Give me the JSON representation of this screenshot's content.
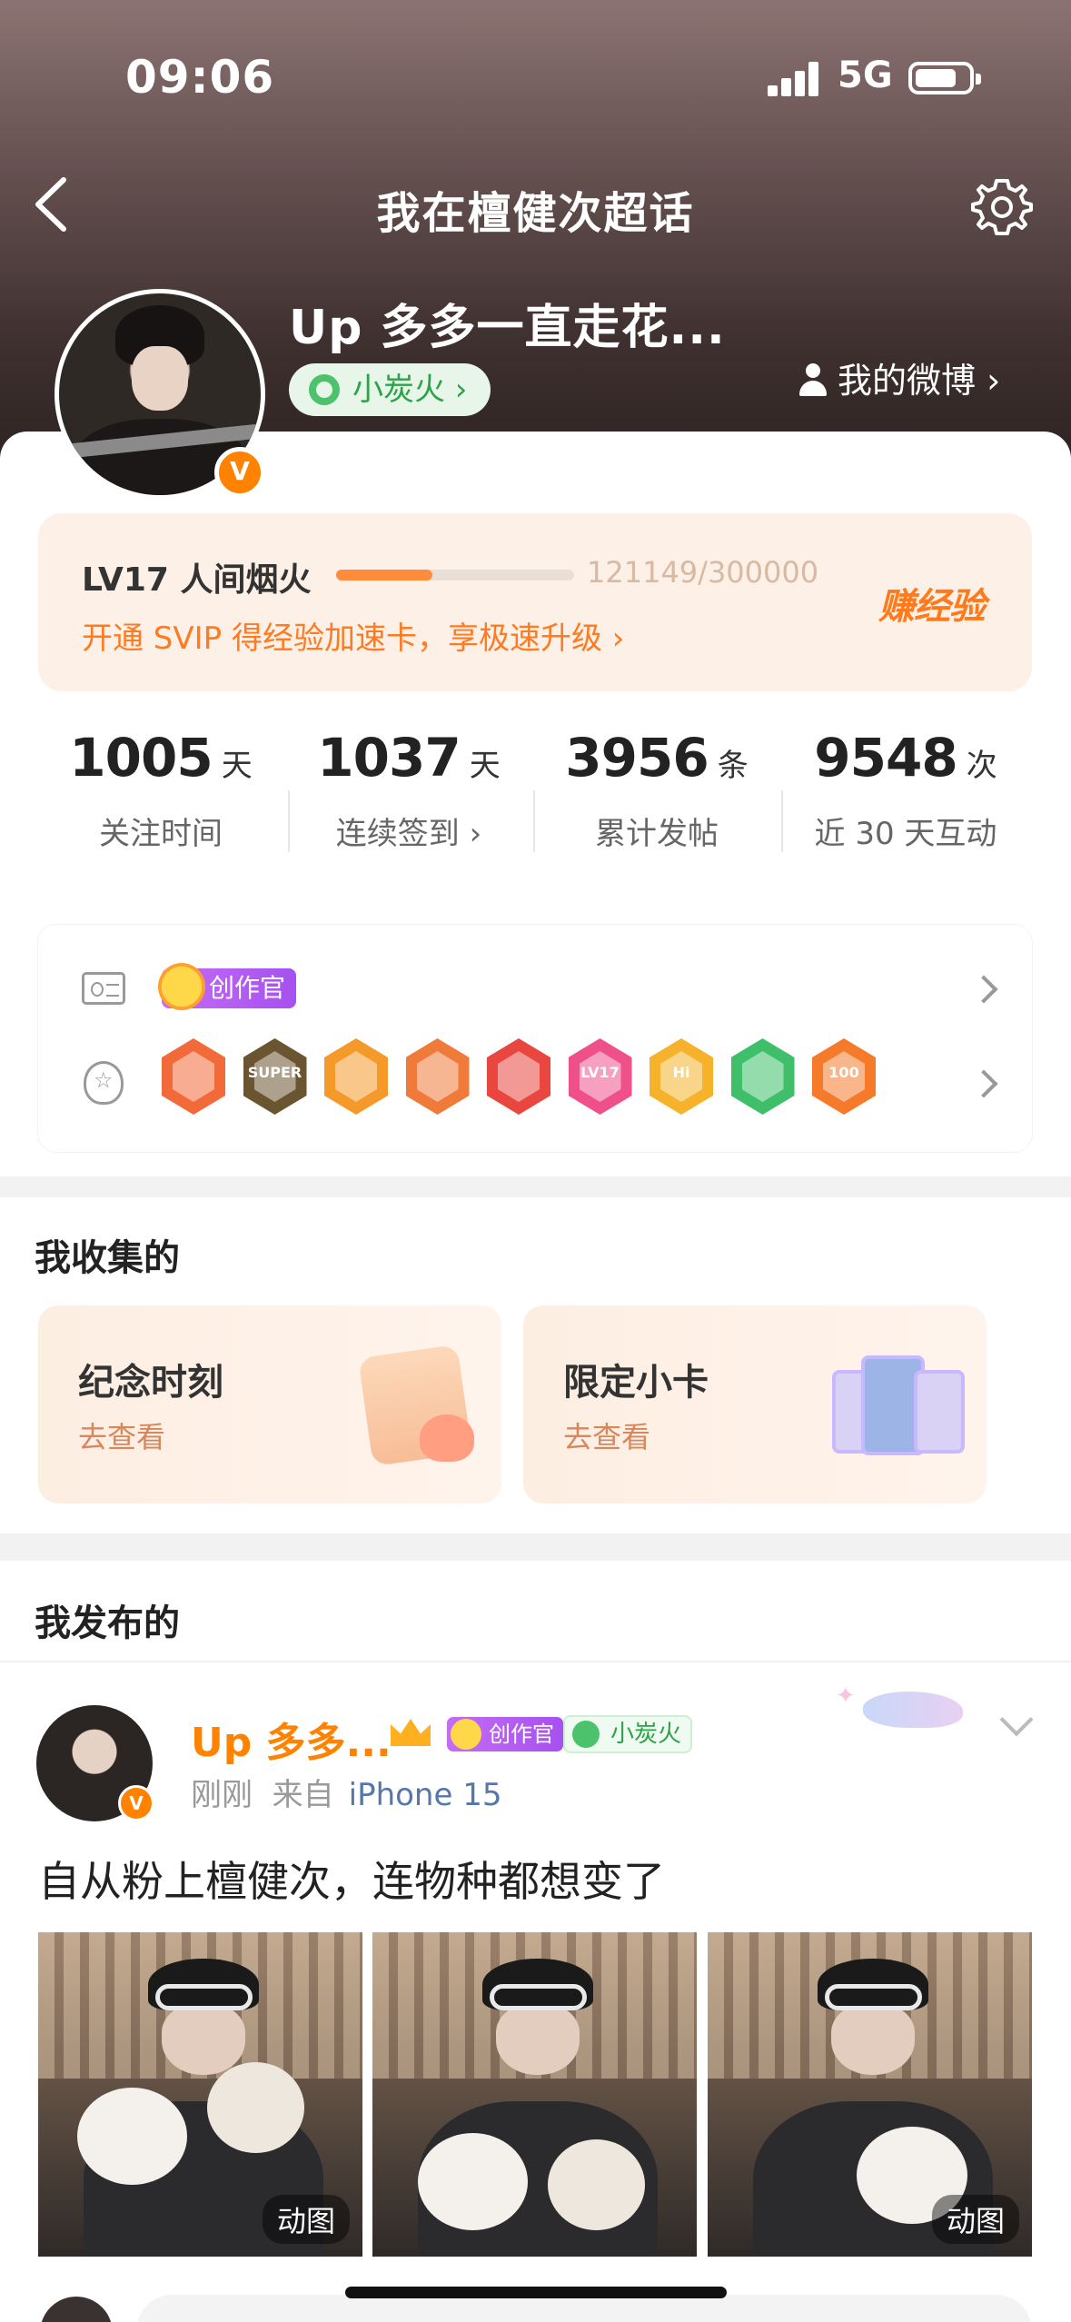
{
  "status_bar": {
    "time": "09:06",
    "network": "5G"
  },
  "nav": {
    "title": "我在檀健次超话"
  },
  "profile": {
    "username": "Up 多多一直走花...",
    "level_tag": "小炭火 ›",
    "verified_mark": "V",
    "my_weibo": "我的微博 ›"
  },
  "level": {
    "title": "LV17 人间烟火",
    "progress_text": "121149/300000",
    "progress_fraction": 0.404,
    "promo": "开通 SVIP 得经验加速卡，享极速升级 ›",
    "earn": "赚经验"
  },
  "stats": [
    {
      "num": "1005",
      "unit": "天",
      "label": "关注时间"
    },
    {
      "num": "1037",
      "unit": "天",
      "label": "连续签到 ›"
    },
    {
      "num": "3956",
      "unit": "条",
      "label": "累计发帖"
    },
    {
      "num": "9548",
      "unit": "次",
      "label": "近 30 天互动"
    }
  ],
  "badges": {
    "creator_tag": "创作官",
    "medals": [
      {
        "name": "fox-medal",
        "color": "#f26a3a"
      },
      {
        "name": "super-medal",
        "color": "#6b5530",
        "text": "SUPER"
      },
      {
        "name": "crown-medal",
        "color": "#f59a2a"
      },
      {
        "name": "cat-medal",
        "color": "#f07a3a"
      },
      {
        "name": "cat2-medal",
        "color": "#e8463f"
      },
      {
        "name": "lv17-medal",
        "color": "#f0508a",
        "text": "LV17"
      },
      {
        "name": "hi-medal",
        "color": "#f5b22a",
        "text": "Hi"
      },
      {
        "name": "hand-medal",
        "color": "#3fbf6a"
      },
      {
        "name": "100days-medal",
        "color": "#f57a2a",
        "text": "100"
      }
    ]
  },
  "collections": {
    "title": "我收集的",
    "items": [
      {
        "title": "纪念时刻",
        "sub": "去查看"
      },
      {
        "title": "限定小卡",
        "sub": "去查看"
      }
    ]
  },
  "posts": {
    "title": "我发布的",
    "item": {
      "name": "Up 多多...",
      "creator_tag": "创作官",
      "fire_tag": "小炭火",
      "time": "刚刚",
      "from": "来自",
      "device": "iPhone 15",
      "text": "自从粉上檀健次，连物种都想变了",
      "gif_label": "动图"
    }
  }
}
